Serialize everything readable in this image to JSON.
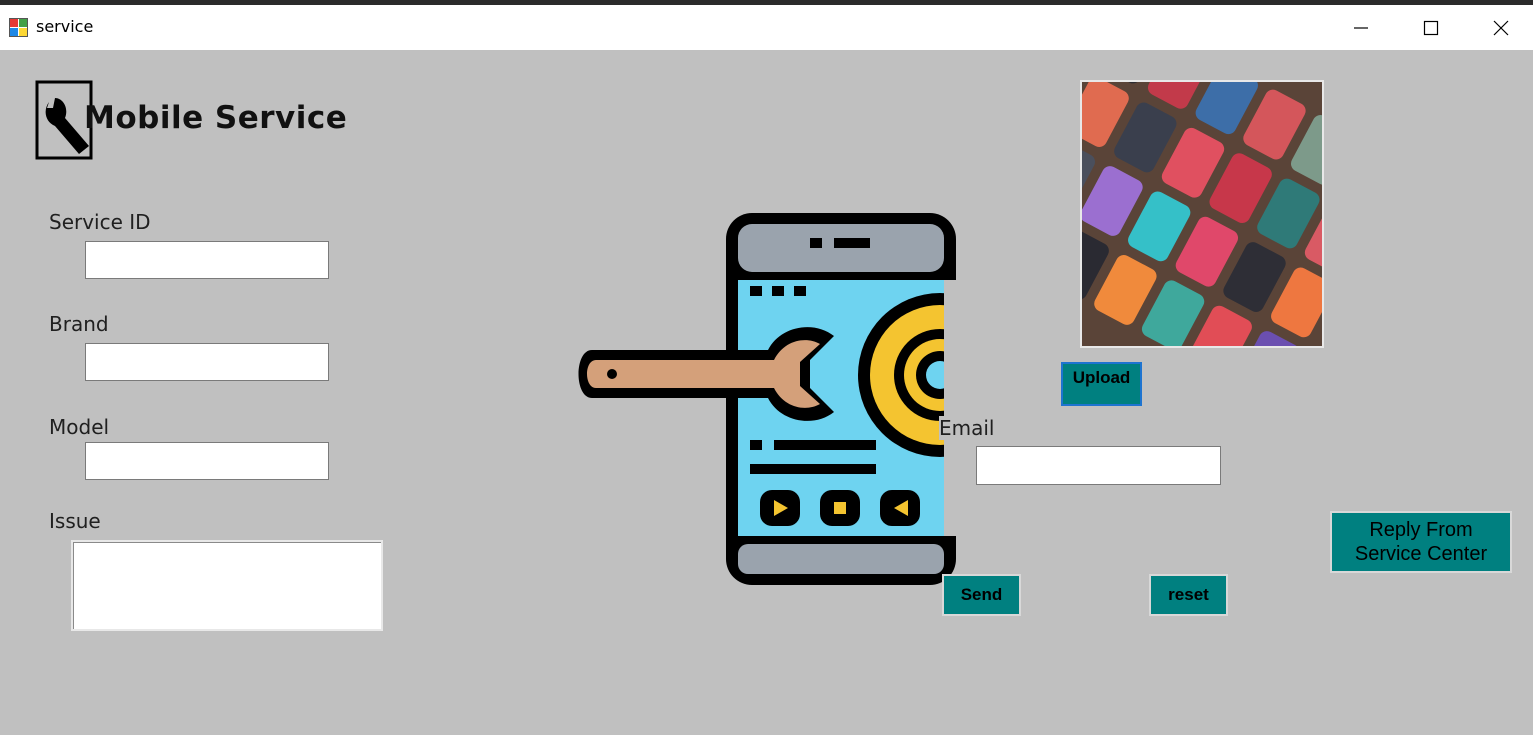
{
  "window": {
    "title": "service"
  },
  "header": {
    "app_title": "Mobile Service"
  },
  "form": {
    "service_id_label": "Service ID",
    "service_id_value": "",
    "brand_label": "Brand",
    "brand_value": "",
    "model_label": "Model",
    "model_value": "",
    "issue_label": "Issue",
    "issue_value": "",
    "email_label": "Email",
    "email_value": ""
  },
  "buttons": {
    "upload": "Upload",
    "send": "Send",
    "reset": "reset",
    "reply_line1": "Reply From",
    "reply_line2": "Service Center"
  },
  "colors": {
    "button_teal": "#008080",
    "form_background": "#c0c0c0"
  }
}
